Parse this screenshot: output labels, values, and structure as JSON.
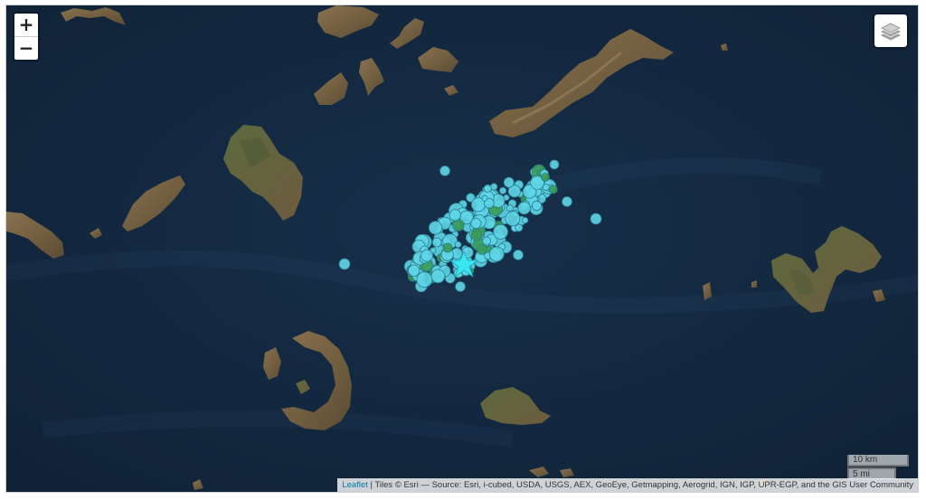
{
  "map": {
    "zoom_in_label": "+",
    "zoom_out_label": "−",
    "layers_icon": "layers-icon",
    "scale": {
      "km_label": "10 km",
      "mi_label": "5 mi"
    },
    "attribution": {
      "leaflet_label": "Leaflet",
      "separator": " | ",
      "tiles_text": "Tiles © Esri — Source: Esri, i-cubed, USDA, USGS, AEX, GeoEye, Getmapping, Aerogrid, IGN, IGP, UPR-EGP, and the GIS User Community"
    },
    "colors": {
      "sea": "#12263d",
      "land": "#6b5a3c",
      "land_light": "#8a7150",
      "vegetation": "#4f5a35",
      "marker_cyan": "#5fd6e8",
      "marker_green": "#3a9a55",
      "epicenter_star": "#39e7f2"
    },
    "epicenter_icon": "star-icon"
  }
}
